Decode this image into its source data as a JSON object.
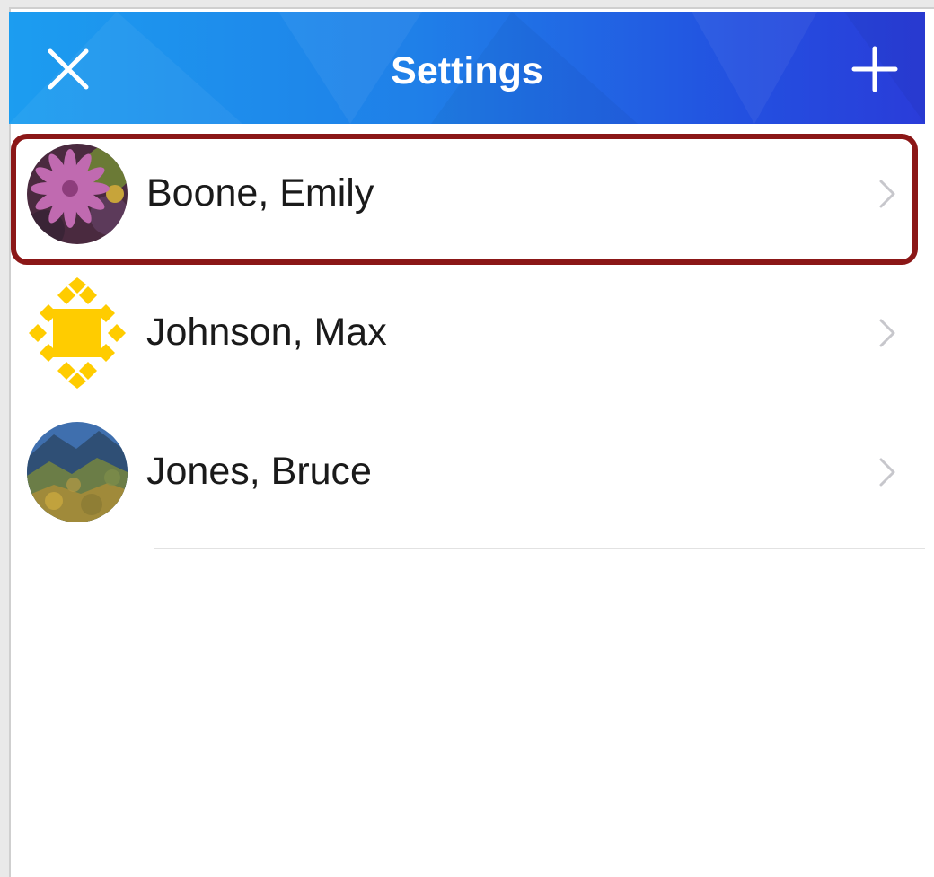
{
  "navbar": {
    "title": "Settings",
    "close_icon": "close-icon",
    "add_icon": "plus-icon",
    "gradient_start": "#1c9df0",
    "gradient_end": "#2a3cd9"
  },
  "users": [
    {
      "name": "Boone, Emily",
      "avatar": "flower-photo-avatar",
      "highlighted": true
    },
    {
      "name": "Johnson, Max",
      "avatar": "yellow-pattern-avatar",
      "highlighted": false
    },
    {
      "name": "Jones, Bruce",
      "avatar": "mountain-photo-avatar",
      "highlighted": false
    }
  ],
  "highlight_color": "#8b1717"
}
